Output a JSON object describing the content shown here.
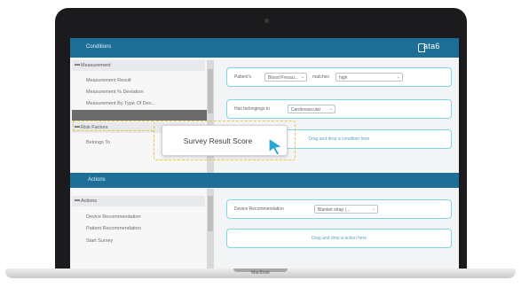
{
  "device": {
    "brand_label": "MacBook"
  },
  "app": {
    "logo_text": "ata6",
    "colors": {
      "primary": "#1e6f97",
      "accent": "#7fd7e3",
      "drag_outline": "#e9c34a",
      "cursor": "#2aa8d4"
    }
  },
  "conditions": {
    "title": "Conditions",
    "group_header": "Measurement",
    "items": [
      "Measurement Result",
      "Measurement % Deviation",
      "Measurement By Type Of Dev..."
    ],
    "second_group_header": "Risk Factors",
    "second_items": [
      "Belongs To"
    ],
    "rules": [
      {
        "prefix": "Patient's",
        "dropdown1": "Blood Pressu...",
        "middle": "matches",
        "dropdown2": "high"
      },
      {
        "prefix": "Has belongings to",
        "dropdown1": "Cardiovascular"
      }
    ],
    "drop_hint": "Drag and drop a condition here"
  },
  "drag_item": {
    "label": "Survey Result Score"
  },
  "actions": {
    "title": "Actions",
    "group_header": "Actions",
    "items": [
      "Device Recommendation",
      "Patient Recommendation",
      "Start Survey"
    ],
    "rule": {
      "prefix": "Device Recommendation",
      "dropdown1": "Blanket strap (..."
    },
    "drop_hint": "Drag and drop a action here"
  }
}
